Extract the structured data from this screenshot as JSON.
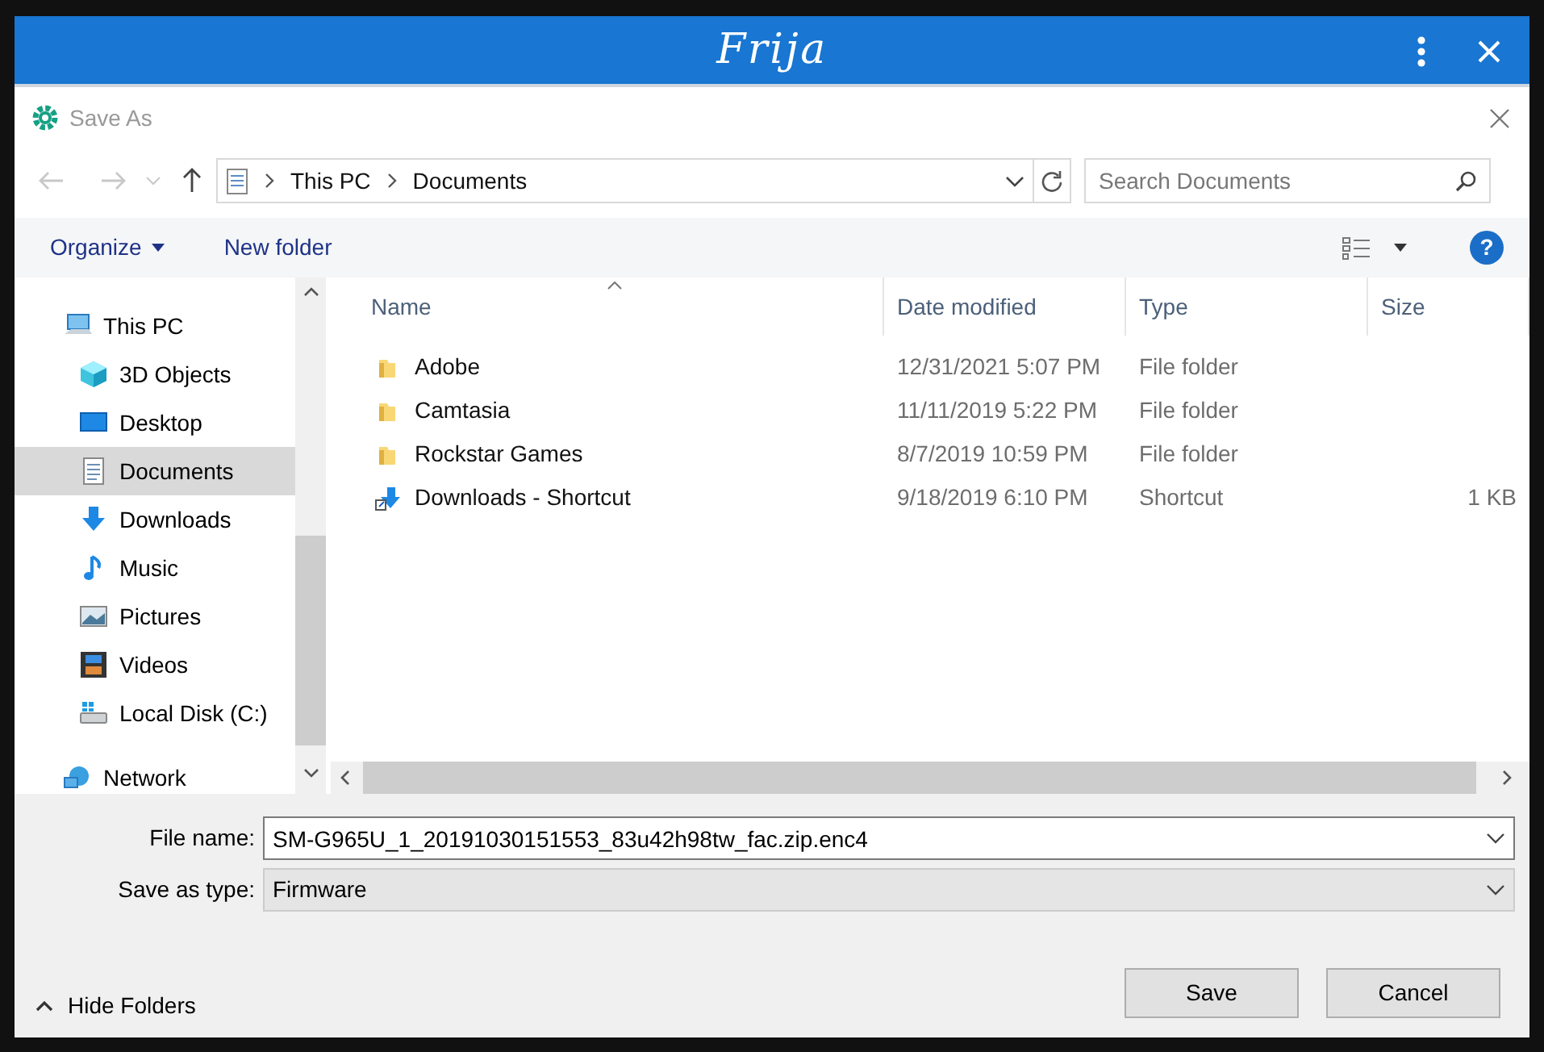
{
  "app_bar": {
    "title": "Frija"
  },
  "dialog": {
    "title": "Save As"
  },
  "address": {
    "segments": [
      "This PC",
      "Documents"
    ]
  },
  "search": {
    "placeholder": "Search Documents"
  },
  "toolbar": {
    "organize": "Organize",
    "new_folder": "New folder",
    "help": "?"
  },
  "sidebar": {
    "items": [
      {
        "label": "This PC",
        "kind": "pc",
        "selected": false,
        "children": [
          {
            "label": "3D Objects",
            "kind": "cube",
            "selected": false
          },
          {
            "label": "Desktop",
            "kind": "desktop",
            "selected": false
          },
          {
            "label": "Documents",
            "kind": "document",
            "selected": true
          },
          {
            "label": "Downloads",
            "kind": "download",
            "selected": false
          },
          {
            "label": "Music",
            "kind": "music",
            "selected": false
          },
          {
            "label": "Pictures",
            "kind": "pictures",
            "selected": false
          },
          {
            "label": "Videos",
            "kind": "videos",
            "selected": false
          },
          {
            "label": "Local Disk (C:)",
            "kind": "disk",
            "selected": false
          }
        ]
      },
      {
        "label": "Network",
        "kind": "network",
        "selected": false
      }
    ]
  },
  "table": {
    "columns": [
      "Name",
      "Date modified",
      "Type",
      "Size"
    ],
    "rows": [
      {
        "kind": "folder",
        "name": "Adobe",
        "date": "12/31/2021 5:07 PM",
        "type": "File folder"
      },
      {
        "kind": "folder",
        "name": "Camtasia",
        "date": "11/11/2019 5:22 PM",
        "type": "File folder"
      },
      {
        "kind": "folder",
        "name": "Rockstar Games",
        "date": "8/7/2019 10:59 PM",
        "type": "File folder"
      },
      {
        "kind": "shortcut",
        "name": "Downloads - Shortcut",
        "date": "9/18/2019 6:10 PM",
        "type": "Shortcut",
        "size": "1 KB"
      }
    ]
  },
  "form": {
    "file_name_label": "File name:",
    "file_name": "SM-G965U_1_20191030151553_83u42h98tw_fac.zip.enc4",
    "type_label": "Save as type:",
    "type": "Firmware"
  },
  "hide_folders": "Hide Folders",
  "buttons": [
    "Save",
    "Cancel"
  ]
}
